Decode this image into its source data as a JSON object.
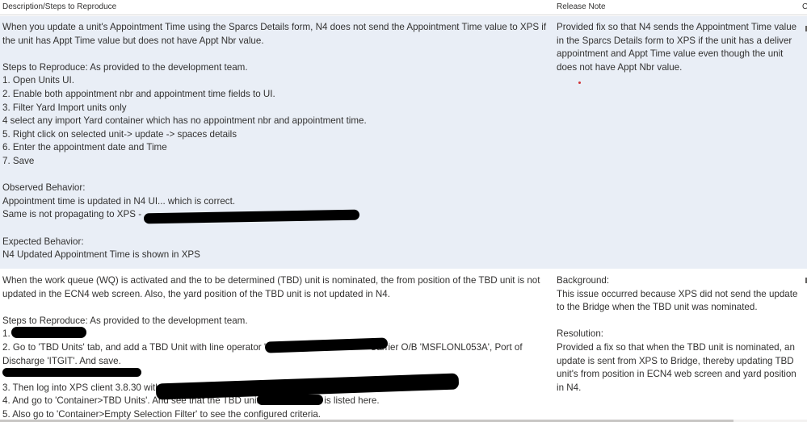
{
  "headers": {
    "description": "Description/Steps to Reproduce",
    "release_note": "Release Note",
    "extra": "C"
  },
  "rows": [
    {
      "description": [
        "When you update a unit's Appointment Time using the Sparcs Details form, N4 does not send the Appointment Time value to XPS if",
        "the unit has Appt Time value but does not have Appt Nbr value.",
        "",
        "Steps to Reproduce: As provided to the development team.",
        "1. Open Units UI.",
        "2. Enable both appointment nbr and appointment time fields to UI.",
        "3. Filter Yard Import units only",
        "4 select any import Yard container which has no appointment nbr and appointment time.",
        "5. Right click on selected unit-> update -> spaces details",
        "6. Enter the appointment date and Time",
        "7. Save",
        "",
        "Observed Behavior:",
        "Appointment time is updated in N4 UI... which is correct.",
        "Same is not propagating to XPS - ",
        "",
        "Expected Behavior:",
        "N4 Updated Appointment Time is shown in XPS"
      ],
      "release_note": [
        "Provided fix so that N4 sends the Appointment Time value",
        "in the Sparcs Details form to XPS if the unit has a deliver",
        "appointment and Appt Time value even though the unit",
        "does not have Appt Nbr value."
      ]
    },
    {
      "description": [
        "When the work queue (WQ) is activated and the to be determined (TBD) unit is nominated, the from position of the TBD unit is not",
        "updated in the ECN4 web screen. Also, the yard position of the TBD unit is not updated in N4.",
        "",
        "Steps to Reproduce: As provided to the development team.",
        "1. ",
        "2. Go to 'TBD Units' tab, and add a TBD Unit with line operator '                                        Carrier O/B 'MSFLONL053A', Port of",
        "Discharge 'ITGIT'. And save.",
        "",
        "3. Then log into XPS client 3.8.30 with",
        "4. And go to 'Container>TBD Units'. And see that the TBD unit                         is listed here.",
        "5. Also go to 'Container>Empty Selection Filter' to see the configured criteria."
      ],
      "release_note": [
        "Background:",
        "This issue occurred because XPS did not send the update",
        "to the Bridge when the TBD unit was nominated.",
        "",
        "Resolution:",
        "Provided a fix so that when the TBD unit is nominated, an",
        "update is sent from XPS to Bridge, thereby updating TBD",
        "unit's from position in ECN4 web screen and yard position",
        "in N4."
      ]
    }
  ]
}
